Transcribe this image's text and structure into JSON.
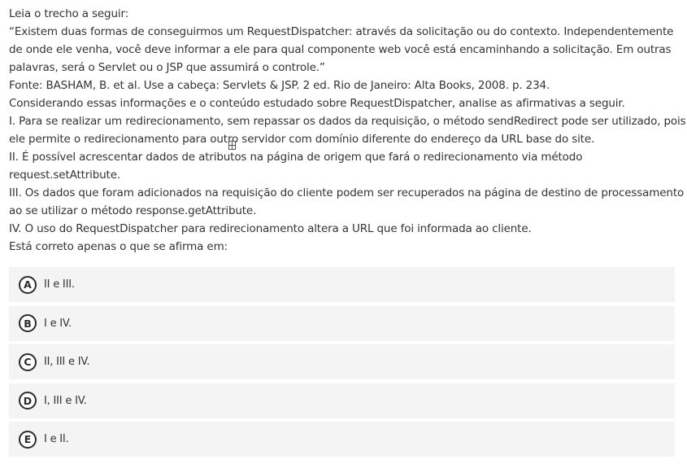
{
  "question": {
    "lines": [
      "Leia o trecho a seguir:",
      "“Existem duas formas de conseguirmos um RequestDispatcher: através da solicitação ou do contexto. Independentemente",
      "de onde ele venha, você deve informar a ele para qual componente web você está encaminhando a solicitação. Em outras",
      "palavras, será o Servlet ou o JSP que assumirá o controle.”",
      "Fonte: BASHAM, B. et al. Use a cabeça: Servlets & JSP. 2 ed. Rio de Janeiro: Alta Books, 2008. p. 234.",
      "Considerando essas informações e o conteúdo estudado sobre RequestDispatcher, analise as afirmativas a seguir.",
      "I. Para se realizar um redirecionamento, sem repassar os dados da requisição, o método sendRedirect pode ser utilizado, pois",
      "ele permite o redirecionamento para outro servidor com domínio diferente do endereço da URL base do site.",
      "II. É possível acrescentar dados de atributos na página de origem que fará o redirecionamento via método",
      "request.setAttribute.",
      "III. Os dados que foram adicionados na requisição do cliente podem ser recuperados na página de destino de processamento",
      "ao se utilizar o método response.getAttribute.",
      "IV. O uso do RequestDispatcher para redirecionamento altera a URL que foi informada ao cliente.",
      "Está correto apenas o que se afirma em:"
    ]
  },
  "alternatives": [
    {
      "letter": "A",
      "text": "II e III."
    },
    {
      "letter": "B",
      "text": "I e IV."
    },
    {
      "letter": "C",
      "text": "II, III e IV."
    },
    {
      "letter": "D",
      "text": "I, III e IV."
    },
    {
      "letter": "E",
      "text": "I e II."
    }
  ],
  "icons": {
    "cursor": "text-cursor-icon"
  }
}
